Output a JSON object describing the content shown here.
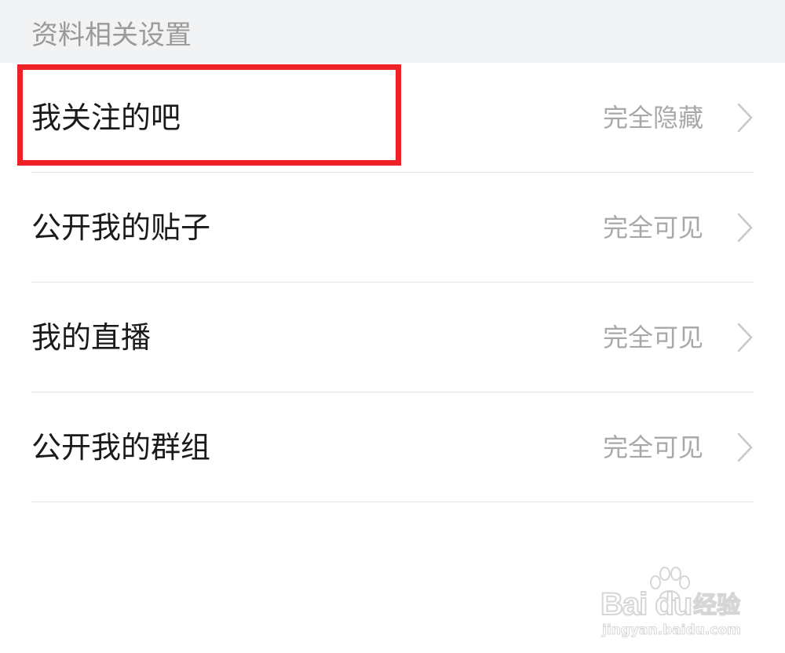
{
  "section": {
    "title": "资料相关设置"
  },
  "rows": [
    {
      "label": "我关注的吧",
      "value": "完全隐藏"
    },
    {
      "label": "公开我的贴子",
      "value": "完全可见"
    },
    {
      "label": "我的直播",
      "value": "完全可见"
    },
    {
      "label": "公开我的群组",
      "value": "完全可见"
    }
  ],
  "icons": {
    "chevron": "chevron-right-icon",
    "watermark_paw": "paw-icon"
  },
  "colors": {
    "highlight": "#ee2129",
    "label": "#1a1a1a",
    "value": "#a8a8a8",
    "section_bg": "#f2f3f5"
  },
  "watermark": {
    "brand": "Bai du",
    "suffix": "经验",
    "url": "jingyan.baidu.com"
  }
}
